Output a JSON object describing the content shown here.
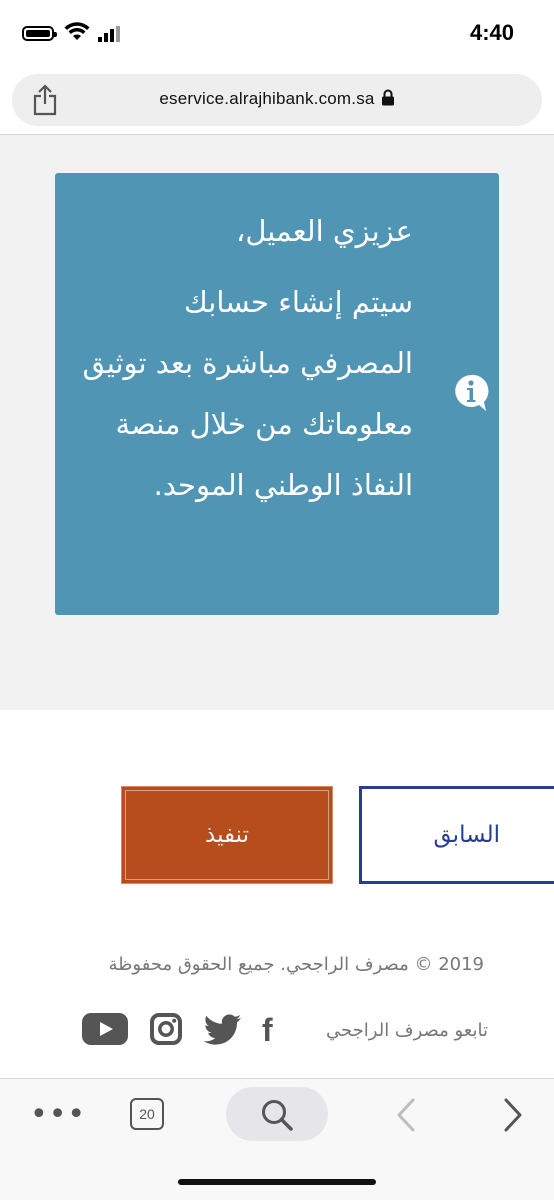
{
  "status_bar": {
    "time": "4:40"
  },
  "browser": {
    "url": "eservice.alrajhibank.com.sa",
    "tab_count": "20"
  },
  "notice": {
    "greeting": "عزيزي العميل،",
    "message": "سيتم إنشاء حسابك المصرفي مباشرة بعد توثيق معلوماتك من خلال منصة النفاذ الوطني الموحد."
  },
  "actions": {
    "execute_label": "تنفيذ",
    "previous_label": "السابق"
  },
  "footer": {
    "copyright": "2019 © مصرف الراجحي. جميع الحقوق محفوظة",
    "follow_label": "تابعو مصرف الراجحي",
    "facebook_glyph": "f"
  },
  "colors": {
    "notice_bg": "#5095b3",
    "execute_bg": "#b74d1c",
    "previous_border": "#273e90"
  },
  "icons": [
    "share-icon",
    "lock-icon",
    "info-icon",
    "facebook-icon",
    "twitter-icon",
    "instagram-icon",
    "youtube-icon",
    "more-icon",
    "tabs-icon",
    "search-icon",
    "back-icon",
    "forward-icon"
  ]
}
